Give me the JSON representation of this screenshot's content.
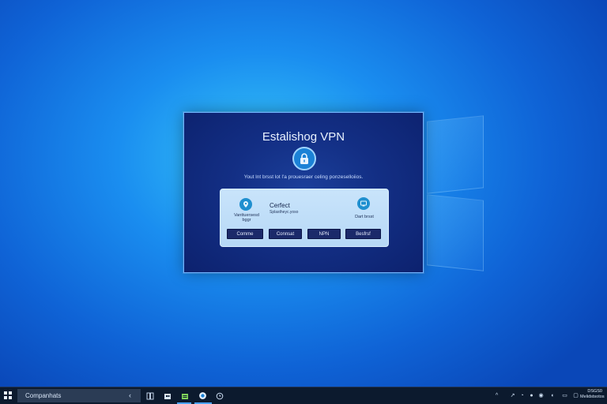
{
  "window": {
    "title": "Estalishog VPN",
    "subtitle": "Yout lnt brsst lot l'a prouesraer celing ponzeselloiios.",
    "left_label": "Vanttuersesd\nbggr",
    "connect_title": "Cerfect",
    "connect_sub": "Splastheyc.yoso",
    "right_label": "Dart brsst",
    "buttons": [
      "Comme",
      "Connsat",
      "NPN",
      "Besfrsf"
    ]
  },
  "taskbar": {
    "search_text": "Companhats",
    "chevron": "‹",
    "clock_line1": "DSGS0",
    "clock_line2": "Melidstsotos"
  },
  "icons": {
    "lock": "lock-icon",
    "pin": "location-pin-icon",
    "device": "computer-icon",
    "start": "windows-start-icon"
  },
  "colors": {
    "accent": "#1b82d6",
    "window_bg": "#132f85",
    "taskbar_bg": "#0c1a2e"
  }
}
